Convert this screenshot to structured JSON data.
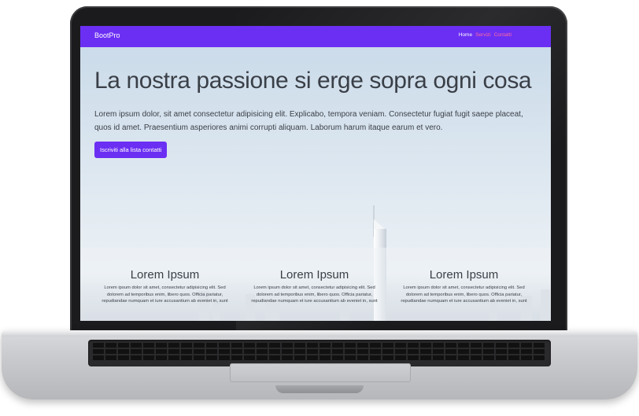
{
  "navbar": {
    "brand": "BootPro",
    "links": [
      "Home",
      "Servizi",
      "Contatti"
    ]
  },
  "hero": {
    "title": "La nostra passione si erge sopra ogni cosa",
    "text": "Lorem ipsum dolor, sit amet consectetur adipisicing elit. Explicabo, tempora veniam. Consectetur fugiat fugit saepe placeat, quos id amet. Praesentium asperiores animi corrupti aliquam. Laborum harum itaque earum et vero.",
    "cta": "Iscriviti alla lista contatti"
  },
  "features": [
    {
      "title": "Lorem Ipsum",
      "text": "Lorem ipsum dolor sit amet, consectetur adipisicing elit. Sed dolorem ad temporibus enim, libero quos. Officia pariatur, repudiandae numquam et iure accusantium ab eveniet in, sunt"
    },
    {
      "title": "Lorem Ipsum",
      "text": "Lorem ipsum dolor sit amet, consectetur adipisicing elit. Sed dolorem ad temporibus enim, libero quos. Officia pariatur, repudiandae numquam et iure accusantium ab eveniet in, sunt"
    },
    {
      "title": "Lorem Ipsum",
      "text": "Lorem ipsum dolor sit amet, consectetur adipisicing elit. Sed dolorem ad temporibus enim, libero quos. Officia pariatur, repudiandae numquam et iure accusantium ab eveniet in, sunt"
    }
  ],
  "colors": {
    "navbar": "#6b2ff3",
    "button": "#6b2ff3",
    "link_inactive": "#ff6aa0"
  }
}
